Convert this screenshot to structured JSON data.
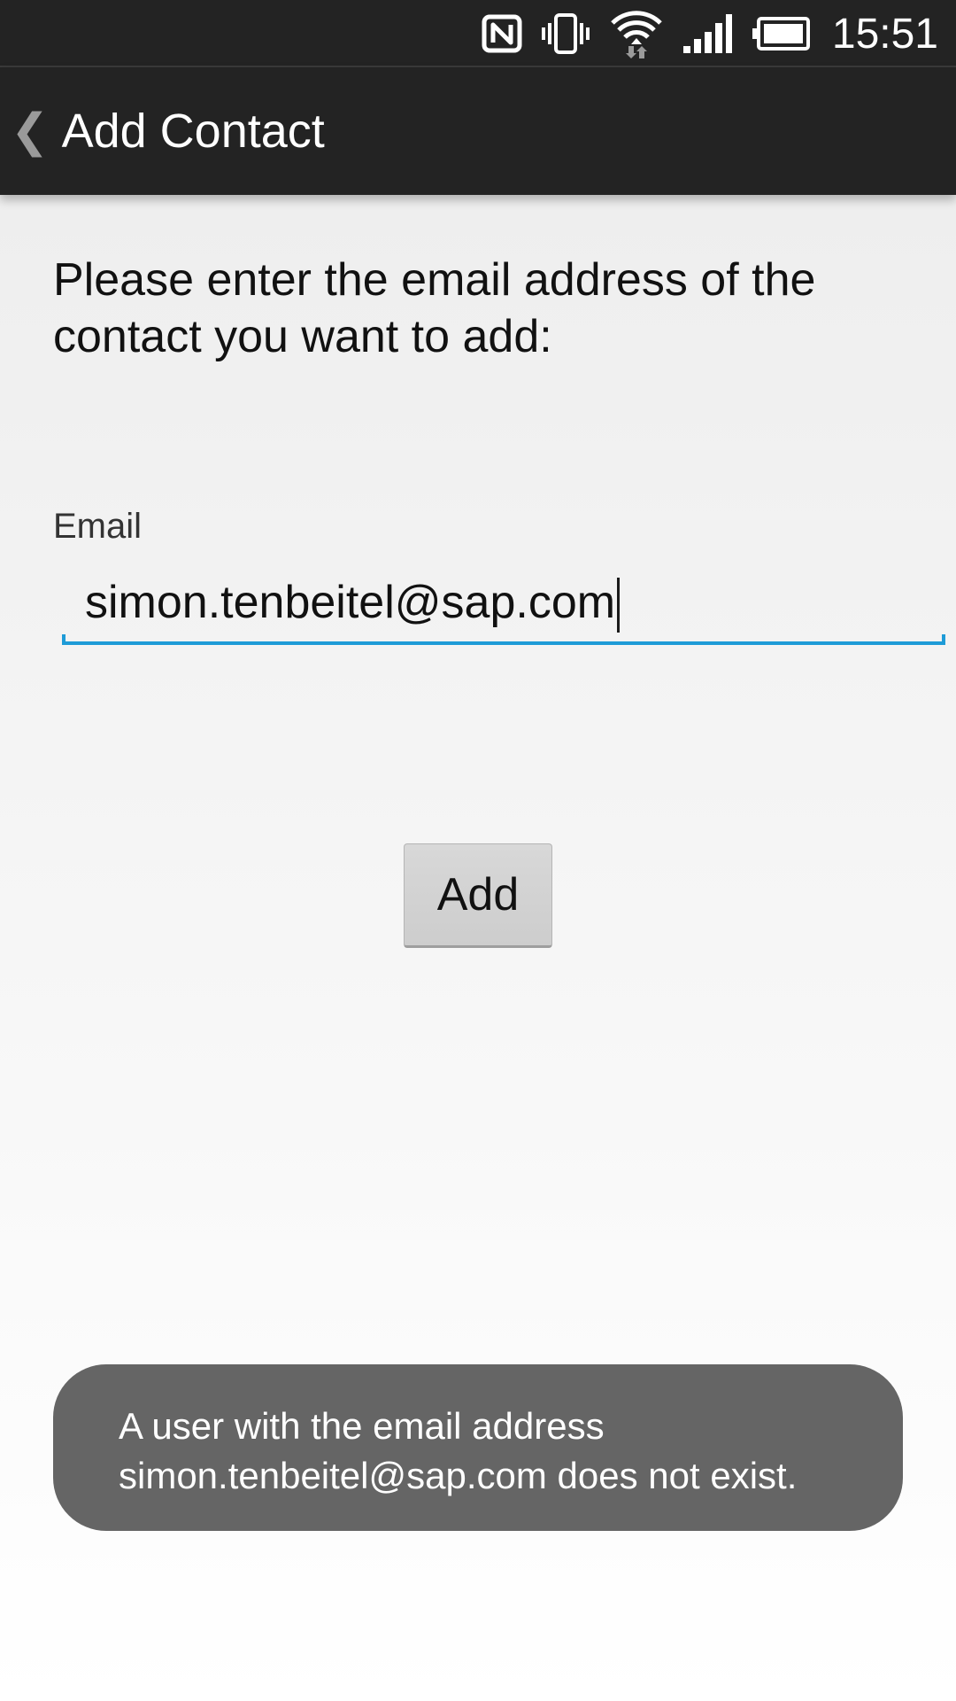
{
  "status_bar": {
    "time": "15:51",
    "icons": [
      "nfc-icon",
      "vibrate-icon",
      "wifi-icon",
      "signal-icon",
      "battery-icon"
    ]
  },
  "action_bar": {
    "back_glyph": "❮",
    "title": "Add Contact"
  },
  "form": {
    "instruction_line1": "Please enter the email address of the",
    "instruction_line2": "contact you want to add:",
    "email_label": "Email",
    "email_value": "simon.tenbeitel@sap.com",
    "add_button_label": "Add"
  },
  "toast": {
    "line1": "A user with the email address",
    "line2": "simon.tenbeitel@sap.com does not exist."
  },
  "colors": {
    "bar_background": "#232323",
    "accent_underline": "#1e9bd7",
    "toast_background": "#656565",
    "button_background": "#d3d3d3"
  }
}
